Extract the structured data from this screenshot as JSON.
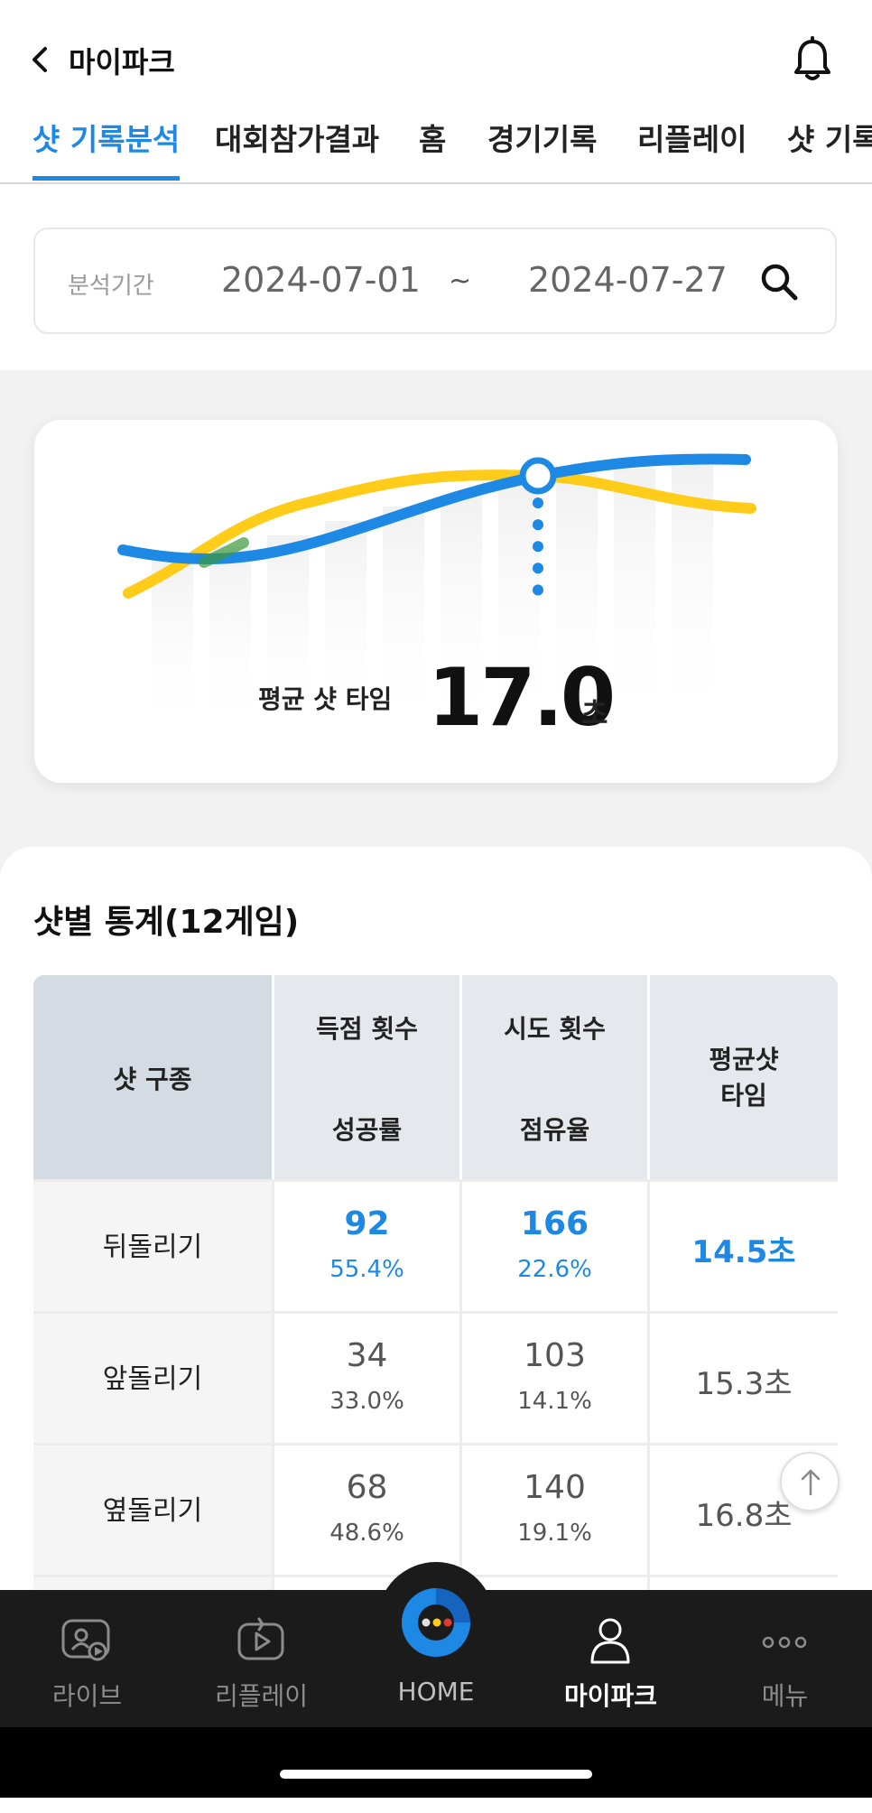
{
  "header": {
    "title": "마이파크"
  },
  "tabs": [
    {
      "label": "샷 기록분석"
    },
    {
      "label": "대회참가결과"
    },
    {
      "label": "홈"
    },
    {
      "label": "경기기록"
    },
    {
      "label": "리플레이"
    },
    {
      "label": "샷 기록"
    }
  ],
  "search": {
    "label": "분석기간",
    "date_from": "2024-07-01",
    "separator": "~",
    "date_to": "2024-07-27"
  },
  "summary": {
    "label": "평균 샷 타임",
    "value": "17.0",
    "unit": "초"
  },
  "stats": {
    "title": "샷별 통계(12게임)",
    "headers": {
      "type": "샷 구종",
      "scores": "득점 횟수",
      "success_rate": "성공률",
      "attempts": "시도 횟수",
      "share": "점유율",
      "avg_time_1": "평균샷",
      "avg_time_2": "타임"
    },
    "rows": [
      {
        "type": "뒤돌리기",
        "scores": "92",
        "success_rate": "55.4%",
        "attempts": "166",
        "share": "22.6%",
        "avg_time": "14.5초"
      },
      {
        "type": "앞돌리기",
        "scores": "34",
        "success_rate": "33.0%",
        "attempts": "103",
        "share": "14.1%",
        "avg_time": "15.3초"
      },
      {
        "type": "옆돌리기",
        "scores": "68",
        "success_rate": "48.6%",
        "attempts": "140",
        "share": "19.1%",
        "avg_time": "16.8초"
      }
    ]
  },
  "nav": [
    {
      "label": "라이브",
      "icon": "live-icon"
    },
    {
      "label": "리플레이",
      "icon": "replay-icon"
    },
    {
      "label": "HOME",
      "icon": "home-logo-icon"
    },
    {
      "label": "마이파크",
      "icon": "person-icon"
    },
    {
      "label": "메뉴",
      "icon": "more-icon"
    }
  ],
  "colors": {
    "accent": "#1e88e5",
    "chart_blue": "#1e88e5",
    "chart_yellow": "#ffcc1a",
    "nav_bg": "#1b1b1b"
  }
}
